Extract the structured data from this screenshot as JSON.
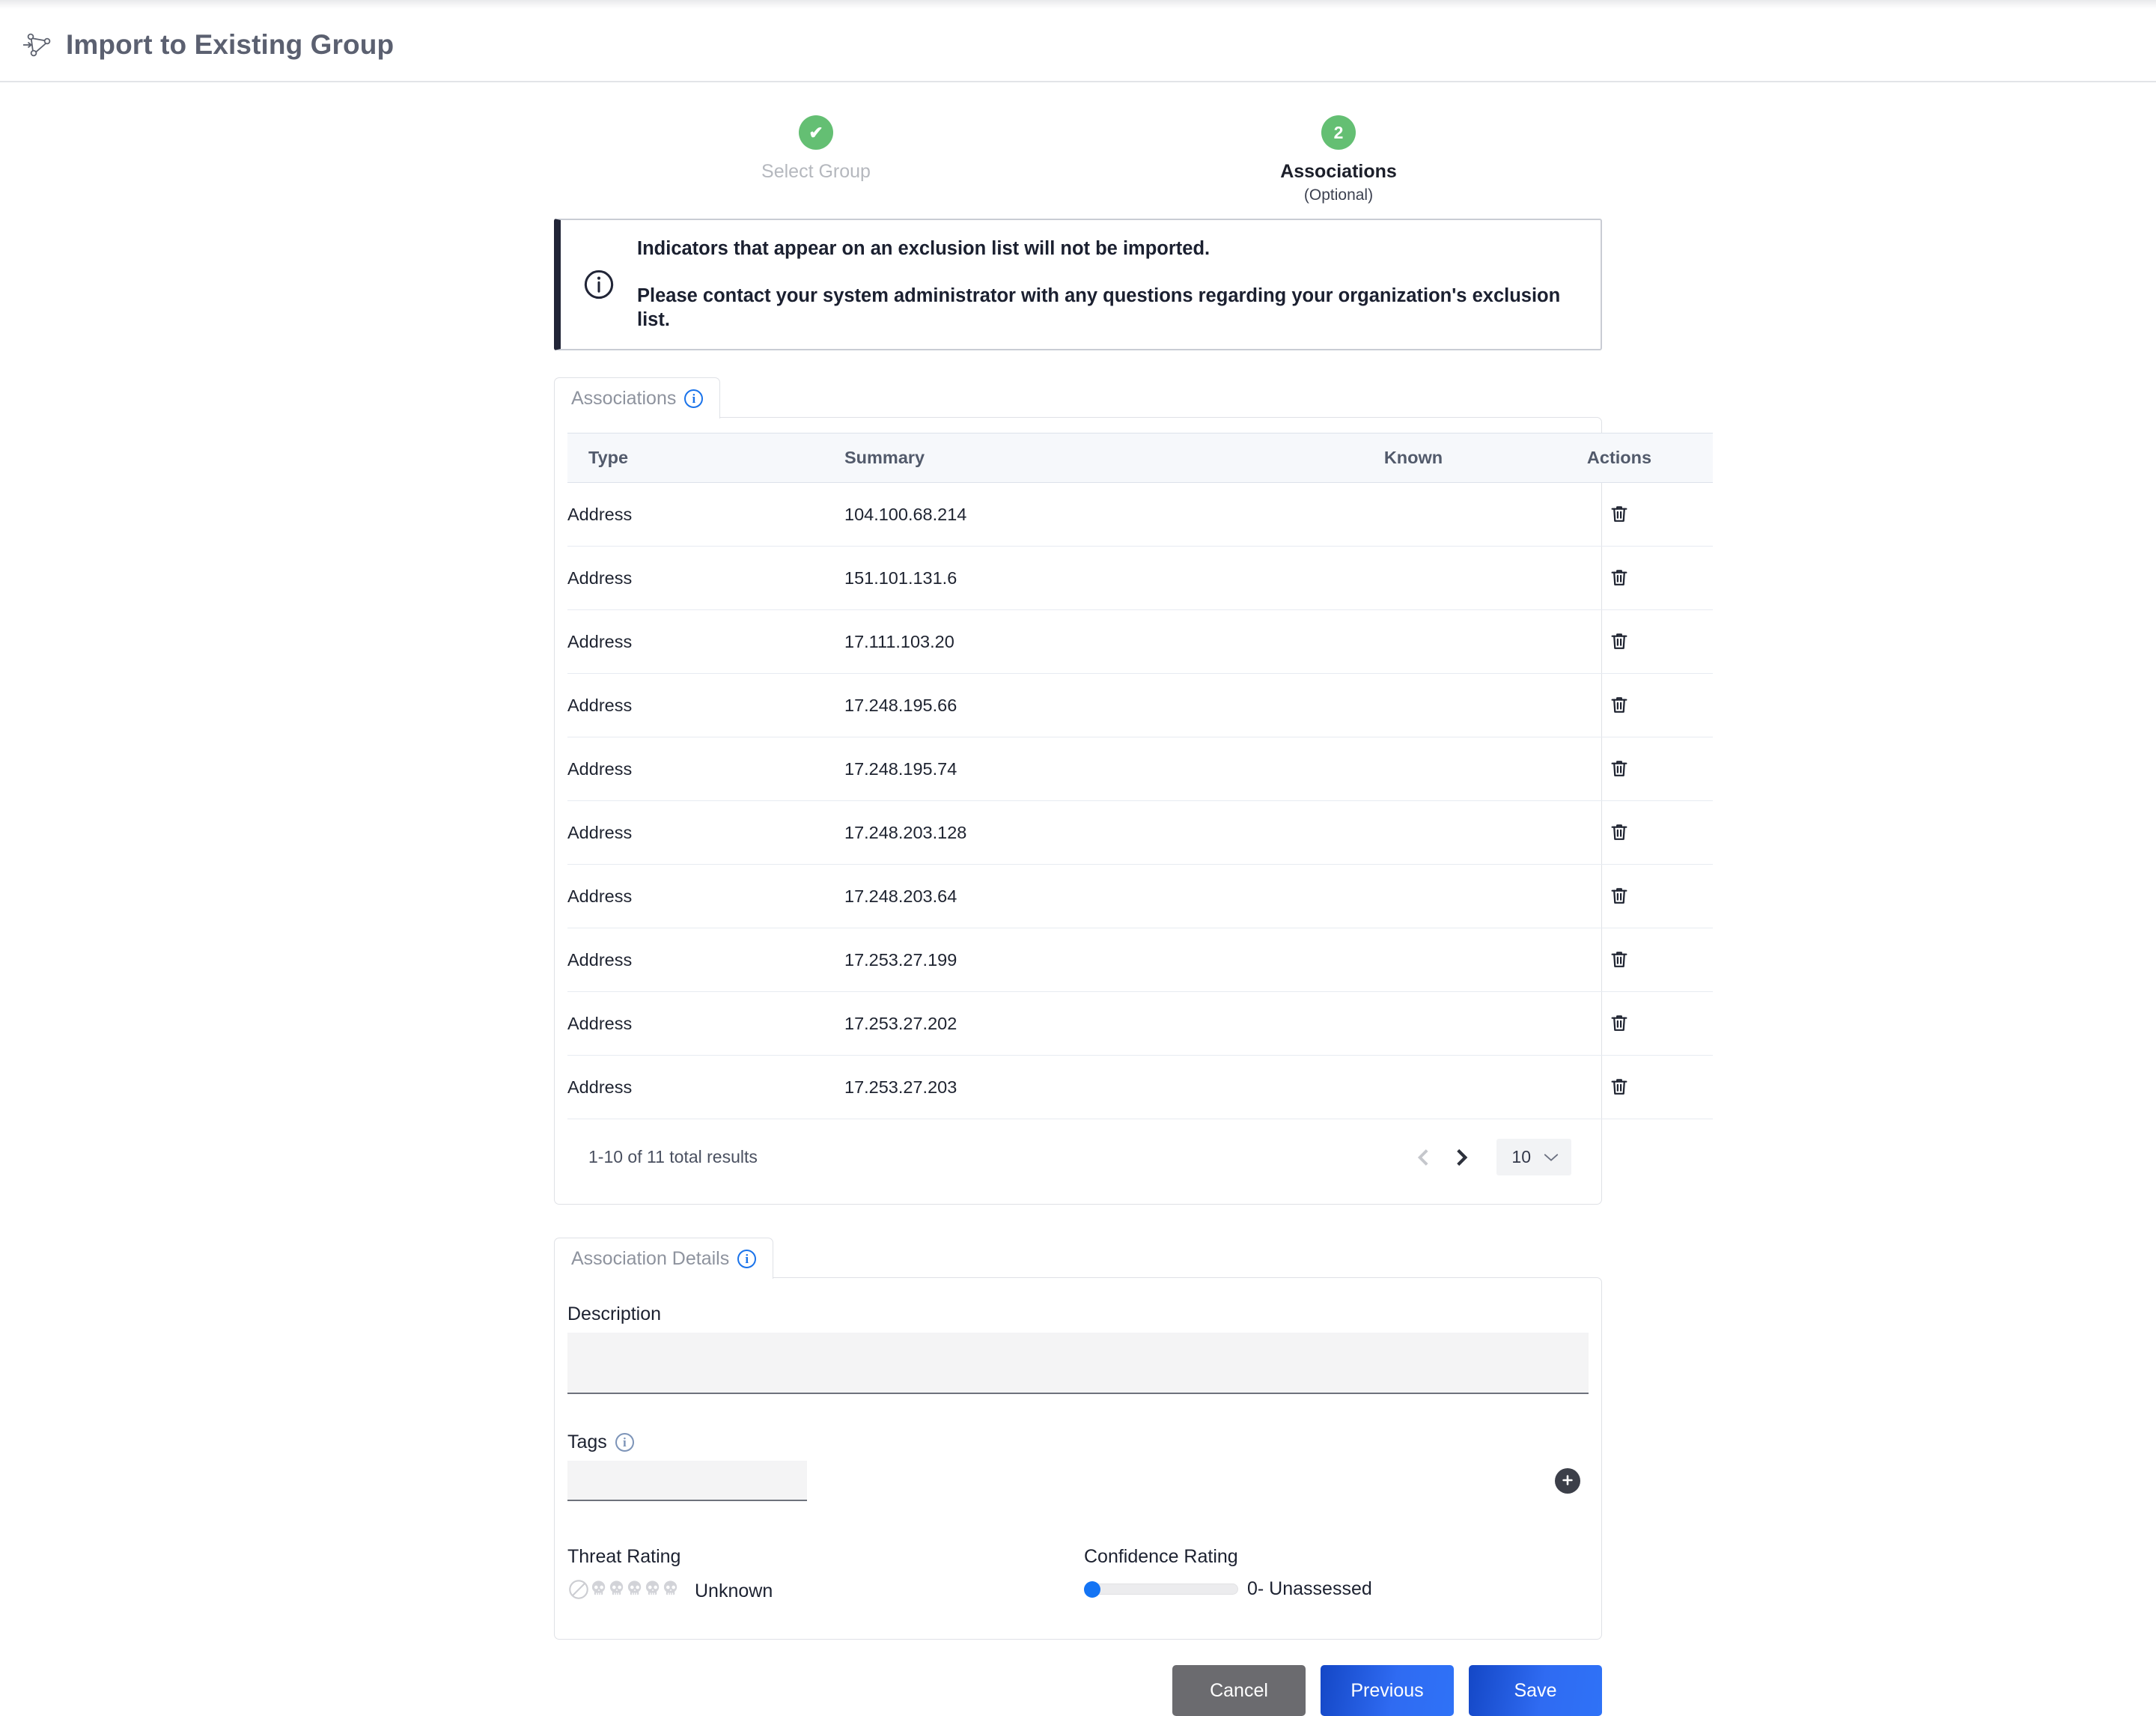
{
  "header": {
    "title": "Import to Existing Group",
    "icon": "import-group-icon"
  },
  "stepper": {
    "steps": [
      {
        "marker": "✔",
        "label": "Select Group",
        "sub": "",
        "state": "complete"
      },
      {
        "marker": "2",
        "label": "Associations",
        "sub": "(Optional)",
        "state": "current"
      }
    ]
  },
  "alert": {
    "icon": "info-circle-icon",
    "lines": [
      "Indicators that appear on an exclusion list will not be imported.",
      "Please contact your system administrator with any questions regarding your organization's exclusion list."
    ]
  },
  "associations_tab": {
    "label": "Associations",
    "info_icon": "info-circle-icon"
  },
  "table": {
    "columns": [
      "Type",
      "Summary",
      "Known",
      "Actions"
    ],
    "action_icon": "trash-icon",
    "rows": [
      {
        "type": "Address",
        "summary": "104.100.68.214",
        "known": ""
      },
      {
        "type": "Address",
        "summary": "151.101.131.6",
        "known": ""
      },
      {
        "type": "Address",
        "summary": "17.111.103.20",
        "known": ""
      },
      {
        "type": "Address",
        "summary": "17.248.195.66",
        "known": ""
      },
      {
        "type": "Address",
        "summary": "17.248.195.74",
        "known": ""
      },
      {
        "type": "Address",
        "summary": "17.248.203.128",
        "known": ""
      },
      {
        "type": "Address",
        "summary": "17.248.203.64",
        "known": ""
      },
      {
        "type": "Address",
        "summary": "17.253.27.199",
        "known": ""
      },
      {
        "type": "Address",
        "summary": "17.253.27.202",
        "known": ""
      },
      {
        "type": "Address",
        "summary": "17.253.27.203",
        "known": ""
      }
    ]
  },
  "pagination": {
    "results_text": "1-10 of 11 total results",
    "prev_icon": "chevron-left-icon",
    "next_icon": "chevron-right-icon",
    "page_size": "10",
    "page_size_caret": "chevron-down-icon"
  },
  "details_tab": {
    "label": "Association Details",
    "info_icon": "info-circle-icon"
  },
  "details": {
    "description_label": "Description",
    "description_value": "",
    "description_placeholder": "",
    "tags_label": "Tags",
    "tags_info_icon": "info-circle-icon",
    "tags_value": "",
    "tags_placeholder": "",
    "add_tag_icon": "plus-icon",
    "threat_rating_label": "Threat Rating",
    "threat_rating_value": "Unknown",
    "threat_rating_icons": [
      "prohibited-icon",
      "skull-icon",
      "skull-icon",
      "skull-icon",
      "skull-icon",
      "skull-icon"
    ],
    "confidence_rating_label": "Confidence Rating",
    "confidence_rating_value": "0- Unassessed",
    "confidence_slider_percent": 0
  },
  "footer": {
    "cancel_label": "Cancel",
    "previous_label": "Previous",
    "save_label": "Save"
  },
  "colors": {
    "step_green": "#64bf73",
    "accent_blue": "#1a73ea",
    "primary_button": "#2f6bf2",
    "cancel_button": "#6b6b6f",
    "alert_border": "#212537",
    "slider_thumb": "#1474f4"
  }
}
